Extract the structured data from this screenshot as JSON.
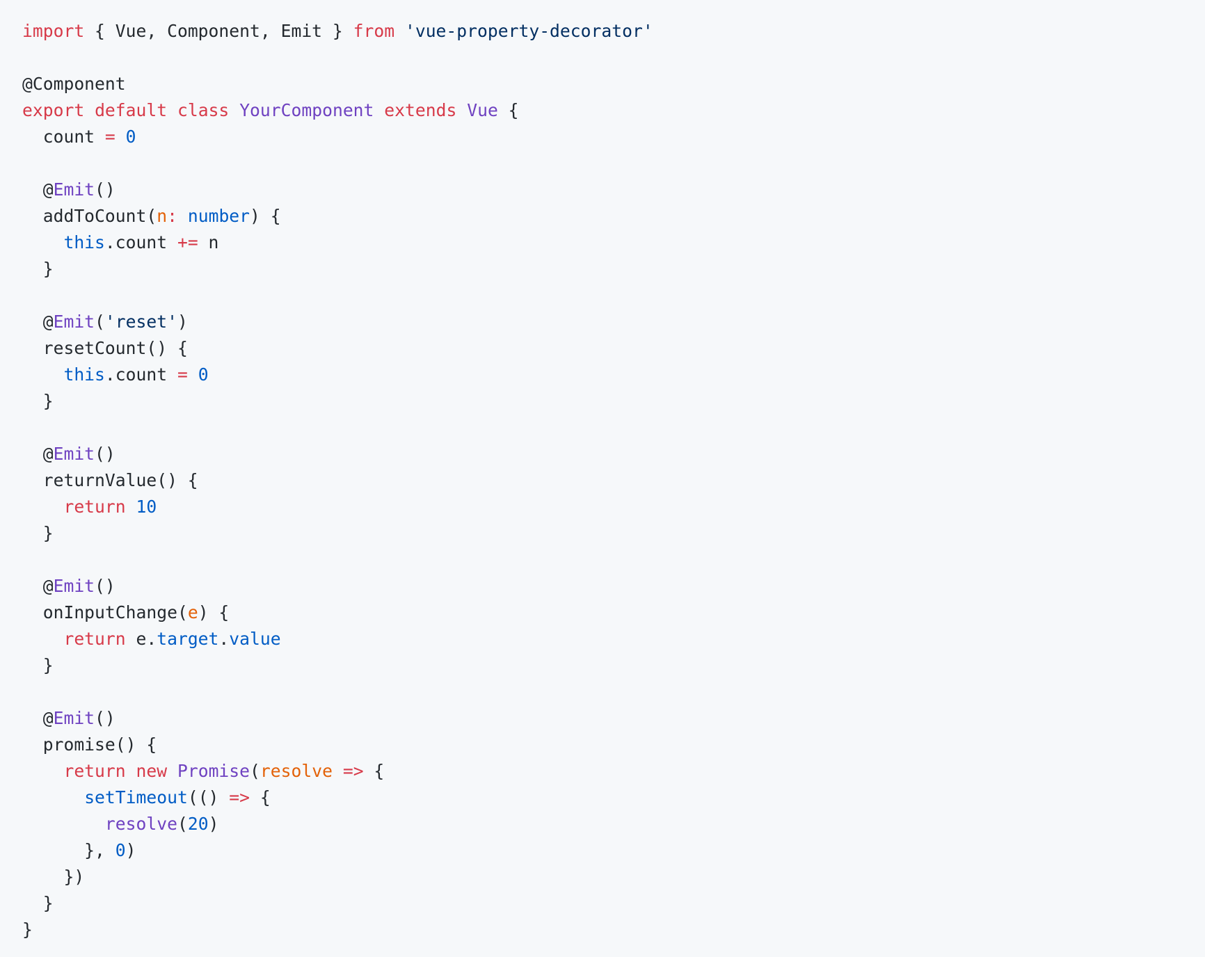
{
  "colors": {
    "background": "#f6f8fa",
    "text": "#24292e",
    "keyword": "#d73a49",
    "string": "#032f62",
    "entity": "#6f42c1",
    "number": "#005cc5",
    "parameter": "#e36209"
  },
  "code": {
    "lines": [
      [
        {
          "t": "import",
          "c": "keyword"
        },
        {
          "t": " { Vue, Component, Emit } ",
          "c": "plain"
        },
        {
          "t": "from",
          "c": "keyword"
        },
        {
          "t": " ",
          "c": "plain"
        },
        {
          "t": "'vue-property-decorator'",
          "c": "string"
        }
      ],
      [],
      [
        {
          "t": "@Component",
          "c": "plain"
        }
      ],
      [
        {
          "t": "export",
          "c": "keyword"
        },
        {
          "t": " ",
          "c": "plain"
        },
        {
          "t": "default",
          "c": "keyword"
        },
        {
          "t": " ",
          "c": "plain"
        },
        {
          "t": "class",
          "c": "keyword"
        },
        {
          "t": " ",
          "c": "plain"
        },
        {
          "t": "YourComponent",
          "c": "entity"
        },
        {
          "t": " ",
          "c": "plain"
        },
        {
          "t": "extends",
          "c": "keyword"
        },
        {
          "t": " ",
          "c": "plain"
        },
        {
          "t": "Vue",
          "c": "entity"
        },
        {
          "t": " {",
          "c": "plain"
        }
      ],
      [
        {
          "t": "  count ",
          "c": "plain"
        },
        {
          "t": "=",
          "c": "operator"
        },
        {
          "t": " ",
          "c": "plain"
        },
        {
          "t": "0",
          "c": "number"
        }
      ],
      [],
      [
        {
          "t": "  @",
          "c": "plain"
        },
        {
          "t": "Emit",
          "c": "decorator-name"
        },
        {
          "t": "()",
          "c": "plain"
        }
      ],
      [
        {
          "t": "  addToCount(",
          "c": "plain"
        },
        {
          "t": "n",
          "c": "param"
        },
        {
          "t": ":",
          "c": "operator"
        },
        {
          "t": " ",
          "c": "plain"
        },
        {
          "t": "number",
          "c": "type"
        },
        {
          "t": ") {",
          "c": "plain"
        }
      ],
      [
        {
          "t": "    ",
          "c": "plain"
        },
        {
          "t": "this",
          "c": "this"
        },
        {
          "t": ".count ",
          "c": "plain"
        },
        {
          "t": "+=",
          "c": "operator"
        },
        {
          "t": " n",
          "c": "plain"
        }
      ],
      [
        {
          "t": "  }",
          "c": "plain"
        }
      ],
      [],
      [
        {
          "t": "  @",
          "c": "plain"
        },
        {
          "t": "Emit",
          "c": "decorator-name"
        },
        {
          "t": "(",
          "c": "plain"
        },
        {
          "t": "'reset'",
          "c": "string"
        },
        {
          "t": ")",
          "c": "plain"
        }
      ],
      [
        {
          "t": "  resetCount() {",
          "c": "plain"
        }
      ],
      [
        {
          "t": "    ",
          "c": "plain"
        },
        {
          "t": "this",
          "c": "this"
        },
        {
          "t": ".count ",
          "c": "plain"
        },
        {
          "t": "=",
          "c": "operator"
        },
        {
          "t": " ",
          "c": "plain"
        },
        {
          "t": "0",
          "c": "number"
        }
      ],
      [
        {
          "t": "  }",
          "c": "plain"
        }
      ],
      [],
      [
        {
          "t": "  @",
          "c": "plain"
        },
        {
          "t": "Emit",
          "c": "decorator-name"
        },
        {
          "t": "()",
          "c": "plain"
        }
      ],
      [
        {
          "t": "  returnValue() {",
          "c": "plain"
        }
      ],
      [
        {
          "t": "    ",
          "c": "plain"
        },
        {
          "t": "return",
          "c": "keyword"
        },
        {
          "t": " ",
          "c": "plain"
        },
        {
          "t": "10",
          "c": "number"
        }
      ],
      [
        {
          "t": "  }",
          "c": "plain"
        }
      ],
      [],
      [
        {
          "t": "  @",
          "c": "plain"
        },
        {
          "t": "Emit",
          "c": "decorator-name"
        },
        {
          "t": "()",
          "c": "plain"
        }
      ],
      [
        {
          "t": "  onInputChange(",
          "c": "plain"
        },
        {
          "t": "e",
          "c": "param"
        },
        {
          "t": ") {",
          "c": "plain"
        }
      ],
      [
        {
          "t": "    ",
          "c": "plain"
        },
        {
          "t": "return",
          "c": "keyword"
        },
        {
          "t": " e.",
          "c": "plain"
        },
        {
          "t": "target",
          "c": "prop"
        },
        {
          "t": ".",
          "c": "plain"
        },
        {
          "t": "value",
          "c": "prop"
        }
      ],
      [
        {
          "t": "  }",
          "c": "plain"
        }
      ],
      [],
      [
        {
          "t": "  @",
          "c": "plain"
        },
        {
          "t": "Emit",
          "c": "decorator-name"
        },
        {
          "t": "()",
          "c": "plain"
        }
      ],
      [
        {
          "t": "  promise() {",
          "c": "plain"
        }
      ],
      [
        {
          "t": "    ",
          "c": "plain"
        },
        {
          "t": "return",
          "c": "keyword"
        },
        {
          "t": " ",
          "c": "plain"
        },
        {
          "t": "new",
          "c": "keyword"
        },
        {
          "t": " ",
          "c": "plain"
        },
        {
          "t": "Promise",
          "c": "entity"
        },
        {
          "t": "(",
          "c": "plain"
        },
        {
          "t": "resolve",
          "c": "param"
        },
        {
          "t": " ",
          "c": "plain"
        },
        {
          "t": "=>",
          "c": "operator"
        },
        {
          "t": " {",
          "c": "plain"
        }
      ],
      [
        {
          "t": "      ",
          "c": "plain"
        },
        {
          "t": "setTimeout",
          "c": "prop"
        },
        {
          "t": "(() ",
          "c": "plain"
        },
        {
          "t": "=>",
          "c": "operator"
        },
        {
          "t": " {",
          "c": "plain"
        }
      ],
      [
        {
          "t": "        ",
          "c": "plain"
        },
        {
          "t": "resolve",
          "c": "entity"
        },
        {
          "t": "(",
          "c": "plain"
        },
        {
          "t": "20",
          "c": "number"
        },
        {
          "t": ")",
          "c": "plain"
        }
      ],
      [
        {
          "t": "      }, ",
          "c": "plain"
        },
        {
          "t": "0",
          "c": "number"
        },
        {
          "t": ")",
          "c": "plain"
        }
      ],
      [
        {
          "t": "    })",
          "c": "plain"
        }
      ],
      [
        {
          "t": "  }",
          "c": "plain"
        }
      ],
      [
        {
          "t": "}",
          "c": "plain"
        }
      ]
    ]
  }
}
